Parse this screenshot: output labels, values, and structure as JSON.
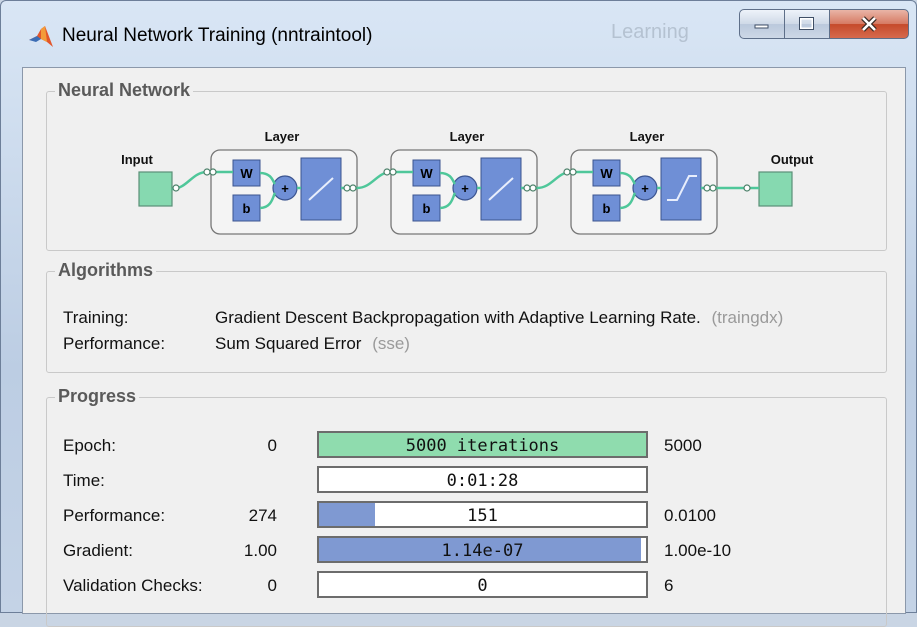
{
  "window": {
    "title": "Neural Network Training (nntraintool)",
    "background_tab_text": "Learning"
  },
  "network": {
    "section_title": "Neural Network",
    "input_label": "Input",
    "output_label": "Output",
    "layers": [
      {
        "label": "Layer",
        "w_label": "W",
        "b_label": "b",
        "sum_label": "+",
        "transfer": "linear"
      },
      {
        "label": "Layer",
        "w_label": "W",
        "b_label": "b",
        "sum_label": "+",
        "transfer": "linear"
      },
      {
        "label": "Layer",
        "w_label": "W",
        "b_label": "b",
        "sum_label": "+",
        "transfer": "saturating-linear"
      }
    ]
  },
  "algorithms": {
    "section_title": "Algorithms",
    "training_label": "Training:",
    "training_value": "Gradient Descent Backpropagation with Adaptive Learning Rate.",
    "training_code": "(traingdx)",
    "performance_label": "Performance:",
    "performance_value": "Sum Squared Error",
    "performance_code": "(sse)"
  },
  "progress": {
    "section_title": "Progress",
    "rows": [
      {
        "label": "Epoch:",
        "start": "0",
        "value": "5000 iterations",
        "end": "5000",
        "fill_fraction": 1.0,
        "fill_color": "#8fdcae"
      },
      {
        "label": "Time:",
        "start": "",
        "value": "0:01:28",
        "end": "",
        "fill_fraction": 0.0,
        "fill_color": "#7f99d2"
      },
      {
        "label": "Performance:",
        "start": "274",
        "value": "151",
        "end": "0.0100",
        "fill_fraction": 0.17,
        "fill_color": "#7f99d2"
      },
      {
        "label": "Gradient:",
        "start": "1.00",
        "value": "1.14e-07",
        "end": "1.00e-10",
        "fill_fraction": 0.985,
        "fill_color": "#7f99d2"
      },
      {
        "label": "Validation Checks:",
        "start": "0",
        "value": "0",
        "end": "6",
        "fill_fraction": 0.0,
        "fill_color": "#7f99d2"
      }
    ]
  },
  "colors": {
    "node_green": "#86d9b0",
    "block_blue": "#6f8fd6",
    "connector_green": "#4fc79a"
  }
}
